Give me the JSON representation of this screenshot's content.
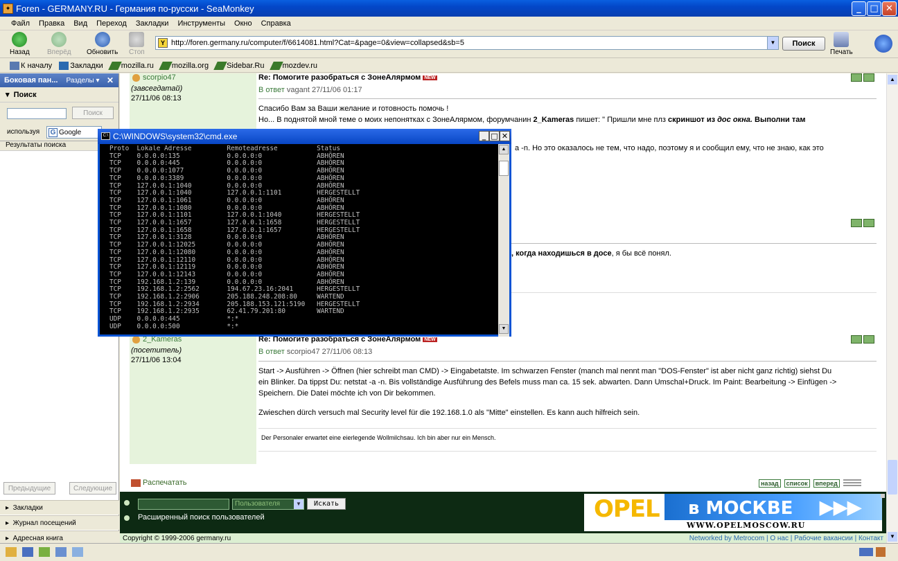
{
  "window": {
    "title": "Foren - GERMANY.RU - Германия по-русски - SeaMonkey",
    "minimize": "_",
    "maximize": "□",
    "close": "✕"
  },
  "menu": [
    "Файл",
    "Правка",
    "Вид",
    "Переход",
    "Закладки",
    "Инструменты",
    "Окно",
    "Справка"
  ],
  "nav": {
    "back": "Назад",
    "forward": "Вперёд",
    "reload": "Обновить",
    "stop": "Стоп",
    "url": "http://foren.germany.ru/computer/f/6614081.html?Cat=&page=0&view=collapsed&sb=5",
    "search": "Поиск",
    "print": "Печать"
  },
  "bookmarks": [
    "К началу",
    "Закладки",
    "mozilla.ru",
    "mozilla.org",
    "Sidebar.Ru",
    "mozdev.ru"
  ],
  "sidebar": {
    "header": "Боковая пан...",
    "sections_dropdown": "Разделы",
    "search_title": "Поиск",
    "search_button": "Поиск",
    "using_label": "используя",
    "engine": "Google",
    "results_label": "Результаты поиска",
    "prev": "Предыдущие",
    "next": "Следующие",
    "footer": [
      "Закладки",
      "Журнал посещений",
      "Адресная книга"
    ]
  },
  "posts": [
    {
      "user": "scorpio47",
      "role": "(завсегдатай)",
      "date": "27/11/06 08:13",
      "title": "Re: Помогите разобраться с ЗонеАлярмом",
      "new_badge": "NEW",
      "reply_prefix": "В ответ",
      "reply_to": "vagant 27/11/06 01:17",
      "body1": "Спасибо Вам за Ваши желание и готовность помочь !",
      "body2a": "Но... В поднятой мной теме о моих непонятках с ЗонеАлярмом, форумчанин ",
      "body2user": "2_Kameras",
      "body2b": " пишет: \" Пришли мне плз ",
      "body2bold": "скриншот из",
      "body2ital": "дос окна.",
      "body2bold2": "Выполни там",
      "body3": "a -n. Но это оказалось не тем, что надо, поэтому я и сообщил ему, что не знаю, как это",
      "body4bold": ", когда находишься в досе",
      "body4": ", я бы всё понял."
    },
    {
      "user": "2_Kameras",
      "role": "(посетитель)",
      "date": "27/11/06 13:04",
      "title": "Re: Помогите разобраться с ЗонеАлярмом",
      "new_badge": "NEW",
      "reply_prefix": "В ответ",
      "reply_to": "scorpio47 27/11/06 08:13",
      "body1": "Start -> Ausführen -> Öffnen (hier schreibt man CMD) -> Eingabetatste. Im schwarzen Fenster (manch mal nennt man \"DOS-Fenster\" ist aber nicht ganz richtig) siehst Du",
      "body2": "ein Blinker. Da tippst Du: netstat -a -n. Bis vollständige Ausführung des Befels muss man ca. 15 sek. abwarten. Dann Umschal+Druck. Im Paint: Bearbeitung -> Einfügen ->",
      "body3": "Speichern. Die Datei möchte ich von Dir bekommen.",
      "body4": "Zwieschen dürch versuch mal Security level für die 192.168.1.0 als \"Mitte\" einstellen. Es kann auch hilfreich sein.",
      "signature": "Der Personaler erwartet eine eierlegende Wollmilchsau. Ich bin aber nur ein Mensch."
    }
  ],
  "print_link": "Распечатать",
  "nav_links": [
    "назад",
    "список",
    "вперед"
  ],
  "bottom": {
    "user_select": "Пользователя",
    "search_btn": "Искать",
    "advanced": "Расширенный поиск пользователей",
    "banner_brand": "OPEL",
    "banner_city": "в МОСКВЕ",
    "banner_url": "WWW.OPELMOSCOW.RU"
  },
  "copyright": "Copyright © 1999-2006 germany.ru",
  "footer_links": "Networked by Metrocom | О нас | Рабочие вакансии | Контакт",
  "cmd": {
    "title": "C:\\WINDOWS\\system32\\cmd.exe",
    "lines": [
      "Proto  Lokale Adresse         Remoteadresse          Status",
      "TCP    0.0.0.0:135            0.0.0.0:0              ABHÖREN",
      "TCP    0.0.0.0:445            0.0.0.0:0              ABHÖREN",
      "TCP    0.0.0.0:1077           0.0.0.0:0              ABHÖREN",
      "TCP    0.0.0.0:3389           0.0.0.0:0              ABHÖREN",
      "TCP    127.0.0.1:1040         0.0.0.0:0              ABHÖREN",
      "TCP    127.0.0.1:1040         127.0.0.1:1101         HERGESTELLT",
      "TCP    127.0.0.1:1061         0.0.0.0:0              ABHÖREN",
      "TCP    127.0.0.1:1080         0.0.0.0:0              ABHÖREN",
      "TCP    127.0.0.1:1101         127.0.0.1:1040         HERGESTELLT",
      "TCP    127.0.0.1:1657         127.0.0.1:1658         HERGESTELLT",
      "TCP    127.0.0.1:1658         127.0.0.1:1657         HERGESTELLT",
      "TCP    127.0.0.1:3128         0.0.0.0:0              ABHÖREN",
      "TCP    127.0.0.1:12025        0.0.0.0:0              ABHÖREN",
      "TCP    127.0.0.1:12080        0.0.0.0:0              ABHÖREN",
      "TCP    127.0.0.1:12110        0.0.0.0:0              ABHÖREN",
      "TCP    127.0.0.1:12119        0.0.0.0:0              ABHÖREN",
      "TCP    127.0.0.1:12143        0.0.0.0:0              ABHÖREN",
      "TCP    192.168.1.2:139        0.0.0.0:0              ABHÖREN",
      "TCP    192.168.1.2:2562       194.67.23.16:2041      HERGESTELLT",
      "TCP    192.168.1.2:2906       205.188.248.208:80     WARTEND",
      "TCP    192.168.1.2:2934       205.188.153.121:5190   HERGESTELLT",
      "TCP    192.168.1.2:2935       62.41.79.201:80        WARTEND",
      "UDP    0.0.0.0:445            *:*",
      "UDP    0.0.0.0:500            *:*"
    ]
  }
}
